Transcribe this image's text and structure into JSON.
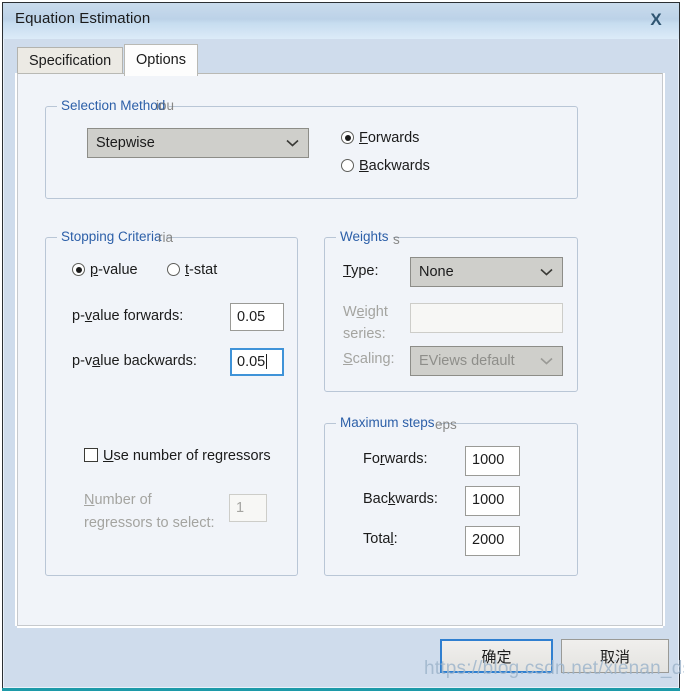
{
  "window": {
    "title": "Equation Estimation",
    "close_label": "X"
  },
  "tabs": [
    {
      "label": "Specification",
      "active": false
    },
    {
      "label": "Options",
      "active": true
    }
  ],
  "selection_method": {
    "title": "Selection Method",
    "ghost": "iou",
    "method_value": "Stepwise",
    "direction": [
      {
        "pre": "",
        "key": "F",
        "post": "orwards",
        "selected": true
      },
      {
        "pre": "",
        "key": "B",
        "post": "ackwards",
        "selected": false
      }
    ]
  },
  "stopping_criteria": {
    "title": "Stopping Criteria",
    "ghost": "ria",
    "criterion": [
      {
        "pre": "",
        "key": "p",
        "post": "-value",
        "selected": true
      },
      {
        "pre": "",
        "key": "t",
        "post": "-stat",
        "selected": false
      }
    ],
    "forwards_label_pre": "p-",
    "forwards_label_key": "v",
    "forwards_label_post": "alue forwards:",
    "forwards_value": "0.05",
    "backwards_label_pre": "p-v",
    "backwards_label_key": "a",
    "backwards_label_post": "lue backwards:",
    "backwards_value": "0.05",
    "use_regressors_pre": "",
    "use_regressors_key": "U",
    "use_regressors_post": "se number of regressors",
    "use_regressors_checked": false,
    "num_regressors_key": "N",
    "num_regressors_line1_post": "umber of",
    "num_regressors_line2": "regressors to select:",
    "num_regressors_value": "1",
    "num_regressors_disabled": true
  },
  "weights": {
    "title": "Weights",
    "ghost": "s",
    "type_label_key": "T",
    "type_label_post": "ype:",
    "type_value": "None",
    "series_label_pre": "W",
    "series_label_key": "e",
    "series_label_post": "ight",
    "series_label_line2": "series:",
    "series_value": "",
    "series_disabled": true,
    "scaling_label_key": "S",
    "scaling_label_post": "caling:",
    "scaling_value": "EViews default",
    "scaling_disabled": true
  },
  "maximum_steps": {
    "title": "Maximum steps",
    "ghost": "eps",
    "rows": [
      {
        "pre": "Fo",
        "key": "r",
        "post": "wards:",
        "value": "1000"
      },
      {
        "pre": "Bac",
        "key": "k",
        "post": "wards:",
        "value": "1000"
      },
      {
        "pre": "Tota",
        "key": "l",
        "post": ":",
        "value": "2000"
      }
    ]
  },
  "footer": {
    "ok_label": "确定",
    "cancel_label": "取消"
  },
  "watermark": {
    "text": "https://blog.csdn.net/xienan_ds_zj"
  },
  "colors": {
    "accent_blue": "#2c5fa8",
    "focus_blue": "#3f93d8",
    "titlebar": "#c6dcef",
    "panel_bg": "#f1f4f9",
    "window_bg": "#cfdcec"
  }
}
